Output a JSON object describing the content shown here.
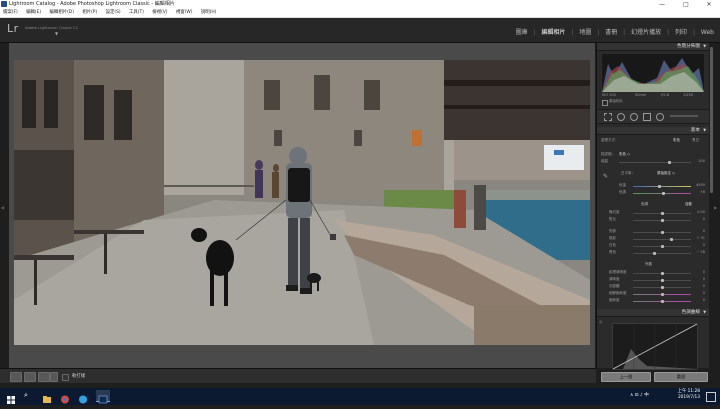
{
  "window": {
    "title": "Lightroom Catalog - Adobe Photoshop Lightroom Classic - 編輯相片",
    "minimize": "—",
    "maximize": "□",
    "close": "✕"
  },
  "menu": [
    "檔案(F)",
    "編輯(E)",
    "編輯相片(D)",
    "相片(P)",
    "設定(S)",
    "工具(T)",
    "檢視(V)",
    "視窗(W)",
    "說明(H)"
  ],
  "identity": {
    "logo": "Lr",
    "subtitle": "Adobe Lightroom Classic CC"
  },
  "modules": {
    "library": "圖庫",
    "develop": "編輯相片",
    "map": "地圖",
    "book": "書冊",
    "slideshow": "幻燈片播放",
    "print": "列印",
    "web": "Web",
    "separator": "|"
  },
  "right_panel": {
    "histogram": {
      "header": "色階分佈圖",
      "readout": [
        "ISO 100",
        "50mm",
        "f/2.8",
        "1/250"
      ],
      "original_photo": "原始相片"
    },
    "basic": {
      "header": "基本",
      "treatment_label": "處理方式：",
      "treatment_color": "彩色",
      "treatment_bw": "黑白",
      "profile_label": "描述檔：",
      "profile_value": "彩色 ◇",
      "amount_label": "總量",
      "amount_value": "100",
      "wb_label": "白平衡：",
      "wb_value": "原始設定 ◇",
      "temp_label": "色溫",
      "temp_value": "4950",
      "tint_label": "色調",
      "tint_value": "+8",
      "tone_label": "色調",
      "tone_auto": "自動",
      "exposure_label": "曝光度",
      "exposure_value": "0.00",
      "contrast_label": "對比",
      "contrast_value": "0",
      "highlights_label": "亮部",
      "highlights_value": "0",
      "shadows_label": "陰影",
      "shadows_value": "+ 31",
      "whites_label": "白色",
      "whites_value": "0",
      "blacks_label": "黑色",
      "blacks_value": "− 28",
      "presence_label": "外觀",
      "texture_label": "紋理清晰度",
      "texture_value": "0",
      "clarity_label": "清晰度",
      "clarity_value": "0",
      "dehaze_label": "去朦朧",
      "dehaze_value": "0",
      "vibrance_label": "細節飽和度",
      "vibrance_value": "0",
      "saturation_label": "飽和度",
      "saturation_value": "0"
    },
    "tone_curve": {
      "header": "色調曲線"
    },
    "previous_button": "上一個",
    "reset_button": "重設"
  },
  "toolbar": {
    "before_after_label": "軟打樣"
  },
  "taskbar": {
    "time": "上午 11:28",
    "date": "2019/7/13",
    "ime": "中",
    "tray": "∧ ⊡ ♪ 中"
  },
  "colors": {
    "accent_taskbar": "#0b1a30",
    "panel_bg": "#2b2b2b",
    "stage_bg": "#4a4a4a"
  }
}
